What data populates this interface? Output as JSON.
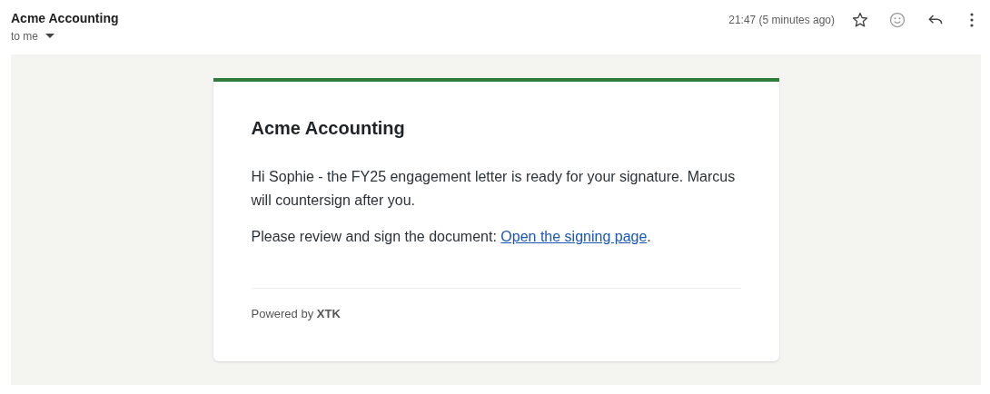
{
  "header": {
    "sender": "Acme Accounting",
    "recipient": "to me",
    "time": "21:47 (5 minutes ago)",
    "starred": false
  },
  "email": {
    "title": "Acme Accounting",
    "paragraphs": [
      {
        "text": "Hi Sophie - the FY25 engagement letter is ready for your signature. Marcus will countersign after you."
      },
      {
        "text": "Please review and sign the document: ",
        "link": "Open the signing page",
        "after": "."
      }
    ],
    "footer": "Powered by **XTK**"
  }
}
